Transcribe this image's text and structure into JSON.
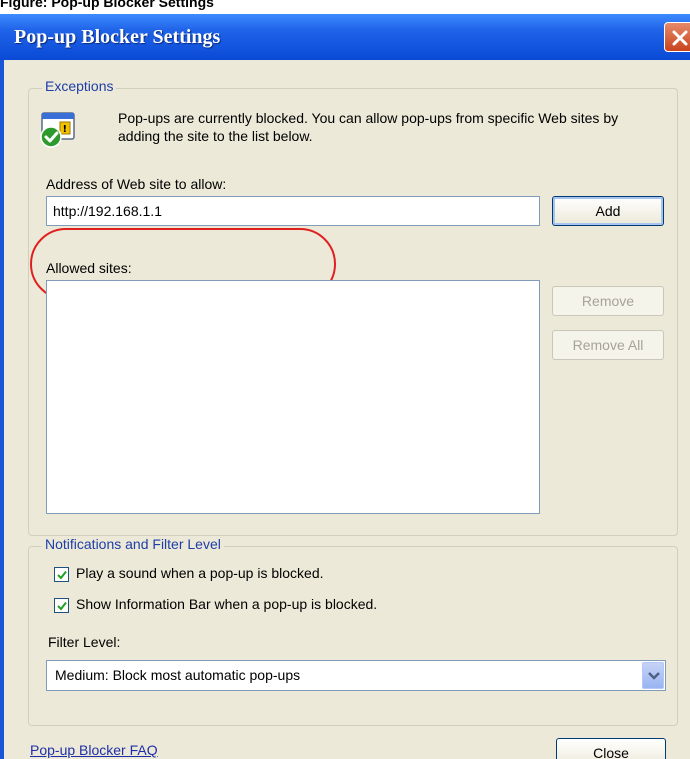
{
  "caption": "Figure: Pop-up Blocker Settings",
  "window": {
    "title": "Pop-up Blocker Settings"
  },
  "exceptions": {
    "legend": "Exceptions",
    "info_text": "Pop-ups are currently blocked.  You can allow pop-ups from specific Web sites by adding the site to the list below.",
    "address_label": "Address of Web site to allow:",
    "address_value": "http://192.168.1.1",
    "add_label": "Add",
    "allowed_label": "Allowed sites:",
    "remove_label": "Remove",
    "remove_all_label": "Remove All"
  },
  "notifications": {
    "legend": "Notifications and Filter Level",
    "play_sound_label": "Play a sound when a pop-up is blocked.",
    "play_sound_checked": true,
    "info_bar_label": "Show Information Bar when a pop-up is blocked.",
    "info_bar_checked": true,
    "filter_level_label": "Filter Level:",
    "filter_level_value": "Medium: Block most automatic pop-ups"
  },
  "footer": {
    "faq_link": "Pop-up Blocker FAQ",
    "close_label": "Close"
  },
  "colors": {
    "titlebar": "#1f63e8",
    "client_bg": "#ece9d8",
    "group_legend": "#1e3ea8",
    "highlight": "#e02020"
  }
}
